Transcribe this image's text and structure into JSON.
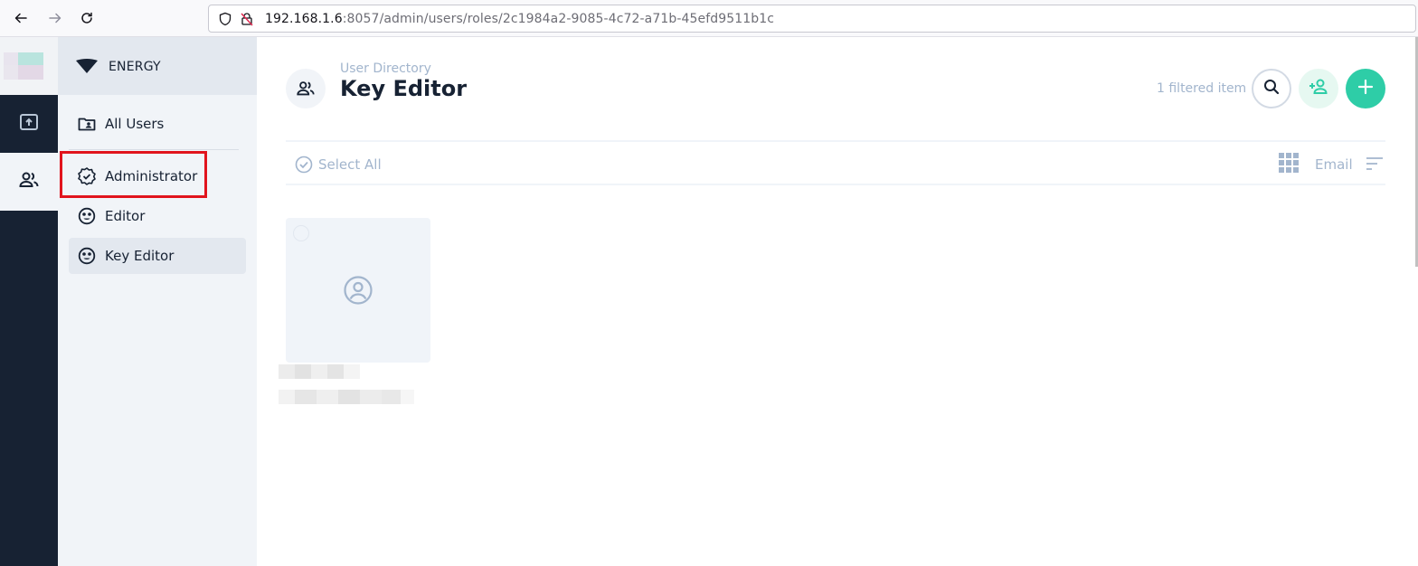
{
  "browser": {
    "url_host": "192.168.1.6",
    "url_rest": ":8057/admin/users/roles/2c1984a2-9085-4c72-a71b-45efd9511b1c",
    "back_icon": "arrow-left-icon",
    "forward_icon": "arrow-right-icon",
    "reload_icon": "reload-icon"
  },
  "rail": {
    "items": [
      {
        "icon": "file-upload-icon",
        "active": false
      },
      {
        "icon": "users-icon",
        "active": true
      }
    ]
  },
  "subnav": {
    "title": "ENERGY",
    "items": [
      {
        "label": "All Users",
        "icon": "folder-user-icon",
        "active": false
      },
      {
        "label": "Administrator",
        "icon": "verified-badge-icon",
        "active": false,
        "highlighted": true
      },
      {
        "label": "Editor",
        "icon": "face-icon",
        "active": false
      },
      {
        "label": "Key Editor",
        "icon": "face-icon",
        "active": true
      }
    ]
  },
  "header": {
    "breadcrumb": "User Directory",
    "title": "Key Editor",
    "filter_count": "1 filtered item",
    "buttons": {
      "search_icon": "search-icon",
      "add_user_icon": "person-add-icon",
      "create_icon": "plus-icon"
    }
  },
  "toolbar": {
    "select_all": "Select All",
    "sort_field": "Email",
    "layout_icon": "grid-icon",
    "sort_icon": "sort-icon"
  },
  "cards": [
    {
      "avatar_icon": "account-circle-icon",
      "selected": false
    }
  ],
  "colors": {
    "rail_bg": "#172233",
    "accent": "#2ecda7",
    "highlight": "#e1141d",
    "muted_text": "#a2b5cd"
  }
}
